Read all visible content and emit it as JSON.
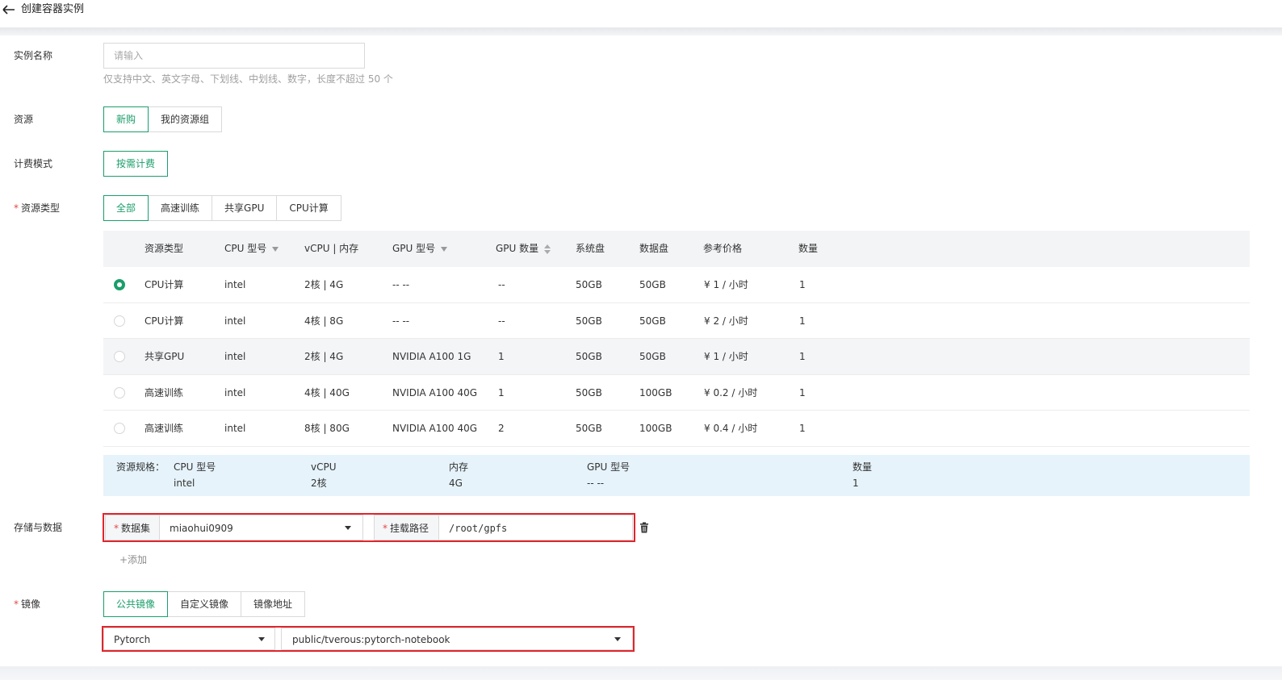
{
  "header": {
    "back_icon": "arrow-left-icon",
    "title": "创建容器实例"
  },
  "form": {
    "name": {
      "label": "实例名称",
      "placeholder": "请输入",
      "hint": "仅支持中文、英文字母、下划线、中划线、数字，长度不超过 50 个"
    },
    "resource": {
      "label": "资源",
      "tabs": [
        "新购",
        "我的资源组"
      ],
      "active": "新购"
    },
    "billing": {
      "label": "计费模式",
      "option": "按需计费"
    },
    "resource_type": {
      "required_mark": "*",
      "label": "资源类型",
      "tabs": [
        "全部",
        "高速训练",
        "共享GPU",
        "CPU计算"
      ],
      "active": "全部"
    },
    "storage": {
      "label": "存储与数据",
      "dataset_label": "数据集",
      "dataset_value": "miaohui0909",
      "mount_label": "挂载路径",
      "mount_value": "/root/gpfs",
      "add_label": "+添加",
      "delete_icon": "trash-icon"
    },
    "image": {
      "label": "镜像",
      "tabs": [
        "公共镜像",
        "自定义镜像",
        "镜像地址"
      ],
      "active": "公共镜像",
      "framework": "Pytorch",
      "image_name": "public/tverous:pytorch-notebook"
    }
  },
  "table": {
    "headers": [
      "资源类型",
      "CPU 型号",
      "vCPU | 内存",
      "GPU 型号",
      "GPU 数量",
      "系统盘",
      "数据盘",
      "参考价格",
      "数量"
    ],
    "rows": [
      {
        "selected": true,
        "type": "CPU计算",
        "cpu": "intel",
        "vcpu_mem": "2核 | 4G",
        "gpu": "-- --",
        "gpu_count": "--",
        "sys_disk": "50GB",
        "data_disk": "50GB",
        "price": "¥ 1 / 小时",
        "qty": "1"
      },
      {
        "selected": false,
        "type": "CPU计算",
        "cpu": "intel",
        "vcpu_mem": "4核 | 8G",
        "gpu": "-- --",
        "gpu_count": "--",
        "sys_disk": "50GB",
        "data_disk": "50GB",
        "price": "¥ 2 / 小时",
        "qty": "1"
      },
      {
        "selected": false,
        "type": "共享GPU",
        "cpu": "intel",
        "vcpu_mem": "2核 | 4G",
        "gpu": "NVIDIA A100 1G",
        "gpu_count": "1",
        "sys_disk": "50GB",
        "data_disk": "50GB",
        "price": "¥ 1 / 小时",
        "qty": "1"
      },
      {
        "selected": false,
        "type": "高速训练",
        "cpu": "intel",
        "vcpu_mem": "4核 | 40G",
        "gpu": "NVIDIA A100 40G",
        "gpu_count": "1",
        "sys_disk": "50GB",
        "data_disk": "100GB",
        "price": "¥ 0.2 / 小时",
        "qty": "1"
      },
      {
        "selected": false,
        "type": "高速训练",
        "cpu": "intel",
        "vcpu_mem": "8核 | 80G",
        "gpu": "NVIDIA A100 40G",
        "gpu_count": "2",
        "sys_disk": "50GB",
        "data_disk": "100GB",
        "price": "¥ 0.4 / 小时",
        "qty": "1"
      }
    ]
  },
  "spec": {
    "title": "资源规格：",
    "cpu_label": "CPU 型号",
    "cpu_value": "intel",
    "vcpu_label": "vCPU",
    "vcpu_value": "2核",
    "mem_label": "内存",
    "mem_value": "4G",
    "gpu_label": "GPU 型号",
    "gpu_value": "-- --",
    "qty_label": "数量",
    "qty_value": "1"
  },
  "colors": {
    "accent": "#1b9e6b",
    "highlight_box": "#e0252c",
    "spec_bg": "#e6f3fb"
  }
}
